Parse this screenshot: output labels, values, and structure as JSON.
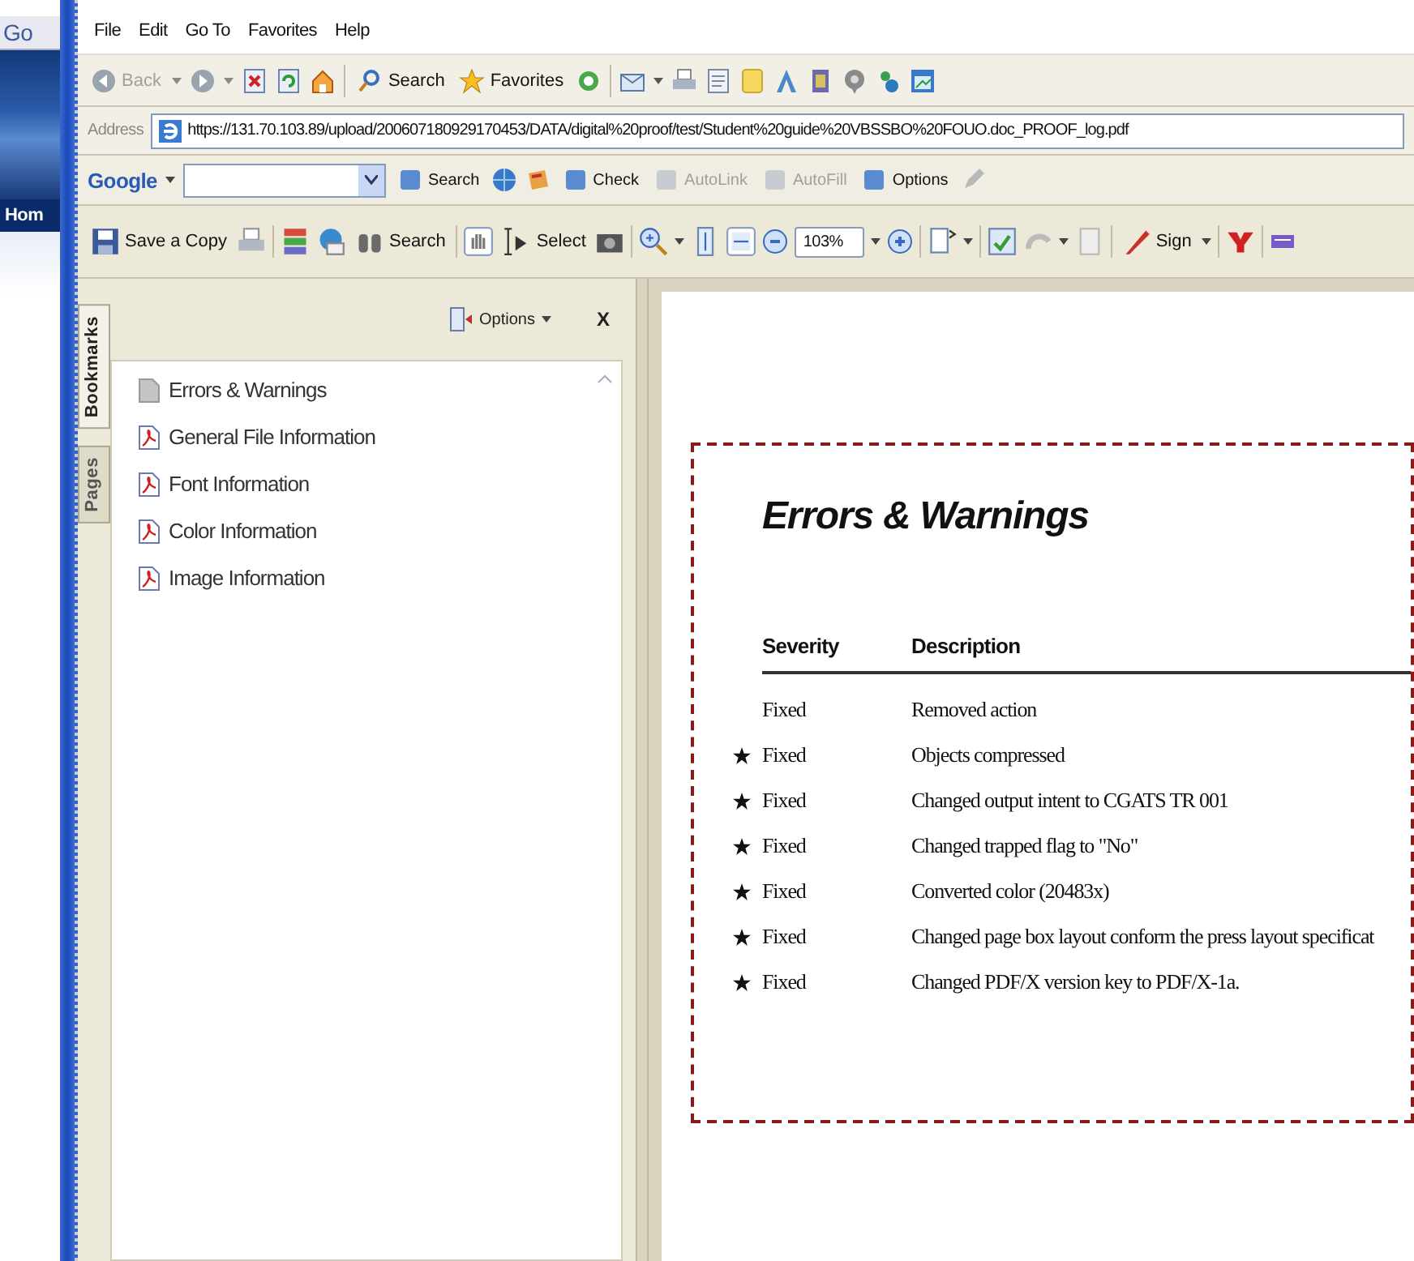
{
  "background_window": {
    "tab_label": "Go",
    "nav_label": "Hom"
  },
  "menu_bar": [
    "File",
    "Edit",
    "Go To",
    "Favorites",
    "Help"
  ],
  "browser_toolbar": {
    "back": {
      "label": "Back",
      "disabled": true
    },
    "search": "Search",
    "favorites": "Favorites"
  },
  "address_bar": {
    "label": "Address",
    "url": "https://131.70.103.89/upload/200607180929170453/DATA/digital%20proof/test/Student%20guide%20VBSSBO%20FOUO.doc_PROOF_log.pdf"
  },
  "google_toolbar": {
    "logo": "Google",
    "buttons": [
      {
        "label": "Search",
        "disabled": false
      },
      {
        "label": "Check",
        "disabled": false
      },
      {
        "label": "AutoLink",
        "disabled": true
      },
      {
        "label": "AutoFill",
        "disabled": true
      },
      {
        "label": "Options",
        "disabled": false
      }
    ]
  },
  "reader_toolbar": {
    "save": "Save a Copy",
    "search": "Search",
    "select": "Select",
    "zoom": "103%",
    "sign": "Sign"
  },
  "side_panel": {
    "tabs": [
      {
        "label": "Bookmarks",
        "selected": true
      },
      {
        "label": "Pages",
        "selected": false
      }
    ],
    "options": "Options",
    "close": "X",
    "bookmarks": [
      {
        "kind": "section",
        "label": "Errors & Warnings"
      },
      {
        "kind": "pdf",
        "label": "General File Information"
      },
      {
        "kind": "pdf",
        "label": "Font Information"
      },
      {
        "kind": "pdf",
        "label": "Color Information"
      },
      {
        "kind": "pdf",
        "label": "Image Information"
      }
    ]
  },
  "document": {
    "title": "Errors & Warnings",
    "columns": [
      "Severity",
      "Description"
    ],
    "rows": [
      {
        "starred": false,
        "severity": "Fixed",
        "description": "Removed action"
      },
      {
        "starred": true,
        "severity": "Fixed",
        "description": "Objects compressed"
      },
      {
        "starred": true,
        "severity": "Fixed",
        "description": "Changed output intent to CGATS TR 001"
      },
      {
        "starred": true,
        "severity": "Fixed",
        "description": "Changed trapped flag to \"No\""
      },
      {
        "starred": true,
        "severity": "Fixed",
        "description": "Converted color (20483x)"
      },
      {
        "starred": true,
        "severity": "Fixed",
        "description": "Changed page box layout conform the press layout specificat"
      },
      {
        "starred": true,
        "severity": "Fixed",
        "description": "Changed PDF/X version key to PDF/X-1a."
      }
    ]
  }
}
